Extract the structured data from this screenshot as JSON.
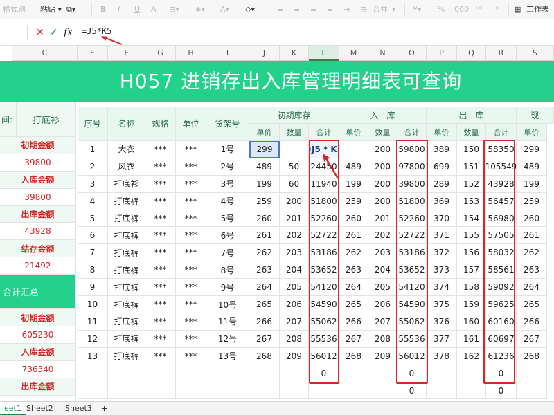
{
  "toolbar": {
    "format_painter": "格式刷",
    "paste": "粘贴",
    "merge": "合并",
    "worksheet": "工作表"
  },
  "formula_bar": {
    "formula": "=J5*K5"
  },
  "columns": [
    "C",
    "E",
    "F",
    "G",
    "H",
    "I",
    "J",
    "K",
    "L",
    "M",
    "N",
    "O",
    "P",
    "Q",
    "R",
    "S"
  ],
  "title": "H057 进销存出入库管理明细表可查询",
  "left_panel": {
    "top_label": "间:",
    "top_value": "打底衫",
    "items": [
      {
        "label": "初期金额",
        "value": "39800"
      },
      {
        "label": "入库金额",
        "value": "39800"
      },
      {
        "label": "出库金额",
        "value": "43928"
      },
      {
        "label": "结存金额",
        "value": "21492"
      }
    ],
    "summary_title": "合计汇总",
    "summary_items": [
      {
        "label": "初期金额",
        "value": "605230"
      },
      {
        "label": "入库金额",
        "value": "736340"
      },
      {
        "label": "出库金额",
        "value": ""
      }
    ]
  },
  "headers": {
    "seq": "序号",
    "name": "名称",
    "spec": "规格",
    "unit": "单位",
    "shelf": "货架号",
    "group_initial": "初期库存",
    "group_in": "入　库",
    "group_out": "出　库",
    "group_stock": "现",
    "price": "单价",
    "qty": "数量",
    "total": "合计"
  },
  "editing_formula": "=J5 * K5",
  "rows": [
    {
      "seq": "1",
      "name": "大衣",
      "spec": "***",
      "unit": "***",
      "shelf": "1号",
      "ip": "299",
      "iq": "",
      "it": "=J5 * K5",
      "inp": "",
      "inq": "200",
      "int": "59800",
      "op": "389",
      "oq": "150",
      "ot": "58350",
      "sp": "299"
    },
    {
      "seq": "2",
      "name": "风衣",
      "spec": "***",
      "unit": "***",
      "shelf": "2号",
      "ip": "489",
      "iq": "50",
      "it": "24450",
      "inp": "489",
      "inq": "200",
      "int": "97800",
      "op": "699",
      "oq": "151",
      "ot": "105549",
      "sp": "489"
    },
    {
      "seq": "3",
      "name": "打底衫",
      "spec": "***",
      "unit": "***",
      "shelf": "3号",
      "ip": "199",
      "iq": "60",
      "it": "11940",
      "inp": "199",
      "inq": "200",
      "int": "39800",
      "op": "289",
      "oq": "152",
      "ot": "43928",
      "sp": "199"
    },
    {
      "seq": "4",
      "name": "打底裤",
      "spec": "***",
      "unit": "***",
      "shelf": "4号",
      "ip": "259",
      "iq": "200",
      "it": "51800",
      "inp": "259",
      "inq": "200",
      "int": "51800",
      "op": "369",
      "oq": "153",
      "ot": "56457",
      "sp": "259"
    },
    {
      "seq": "5",
      "name": "打底裤",
      "spec": "***",
      "unit": "***",
      "shelf": "5号",
      "ip": "260",
      "iq": "201",
      "it": "52260",
      "inp": "260",
      "inq": "201",
      "int": "52260",
      "op": "370",
      "oq": "154",
      "ot": "56980",
      "sp": "260"
    },
    {
      "seq": "6",
      "name": "打底裤",
      "spec": "***",
      "unit": "***",
      "shelf": "6号",
      "ip": "261",
      "iq": "202",
      "it": "52722",
      "inp": "261",
      "inq": "202",
      "int": "52722",
      "op": "371",
      "oq": "155",
      "ot": "57505",
      "sp": "261"
    },
    {
      "seq": "7",
      "name": "打底裤",
      "spec": "***",
      "unit": "***",
      "shelf": "7号",
      "ip": "262",
      "iq": "203",
      "it": "53186",
      "inp": "262",
      "inq": "203",
      "int": "53186",
      "op": "372",
      "oq": "156",
      "ot": "58032",
      "sp": "262"
    },
    {
      "seq": "8",
      "name": "打底裤",
      "spec": "***",
      "unit": "***",
      "shelf": "8号",
      "ip": "263",
      "iq": "204",
      "it": "53652",
      "inp": "263",
      "inq": "204",
      "int": "53652",
      "op": "373",
      "oq": "157",
      "ot": "58561",
      "sp": "263"
    },
    {
      "seq": "9",
      "name": "打底裤",
      "spec": "***",
      "unit": "***",
      "shelf": "9号",
      "ip": "264",
      "iq": "205",
      "it": "54120",
      "inp": "264",
      "inq": "205",
      "int": "54120",
      "op": "374",
      "oq": "158",
      "ot": "59092",
      "sp": "264"
    },
    {
      "seq": "10",
      "name": "打底裤",
      "spec": "***",
      "unit": "***",
      "shelf": "10号",
      "ip": "265",
      "iq": "206",
      "it": "54590",
      "inp": "265",
      "inq": "206",
      "int": "54590",
      "op": "375",
      "oq": "159",
      "ot": "59625",
      "sp": "265"
    },
    {
      "seq": "11",
      "name": "打底裤",
      "spec": "***",
      "unit": "***",
      "shelf": "11号",
      "ip": "266",
      "iq": "207",
      "it": "55062",
      "inp": "266",
      "inq": "207",
      "int": "55062",
      "op": "376",
      "oq": "160",
      "ot": "60160",
      "sp": "266"
    },
    {
      "seq": "12",
      "name": "打底裤",
      "spec": "***",
      "unit": "***",
      "shelf": "12号",
      "ip": "267",
      "iq": "208",
      "it": "55536",
      "inp": "267",
      "inq": "208",
      "int": "55536",
      "op": "377",
      "oq": "161",
      "ot": "60697",
      "sp": "267"
    },
    {
      "seq": "13",
      "name": "打底裤",
      "spec": "***",
      "unit": "***",
      "shelf": "13号",
      "ip": "268",
      "iq": "209",
      "it": "56012",
      "inp": "268",
      "inq": "209",
      "int": "56012",
      "op": "378",
      "oq": "162",
      "ot": "61236",
      "sp": "268"
    }
  ],
  "totals_row_1": {
    "it": "0",
    "int": "0",
    "ot": "0"
  },
  "totals_row_2": {
    "int": "0",
    "ot": "0"
  },
  "sheets": [
    "eet1",
    "Sheet2",
    "Sheet3"
  ],
  "add_sheet": "+",
  "colors": {
    "accent": "#23d18b",
    "highlight": "#d62728",
    "active_tab": "#1a8a4b"
  }
}
